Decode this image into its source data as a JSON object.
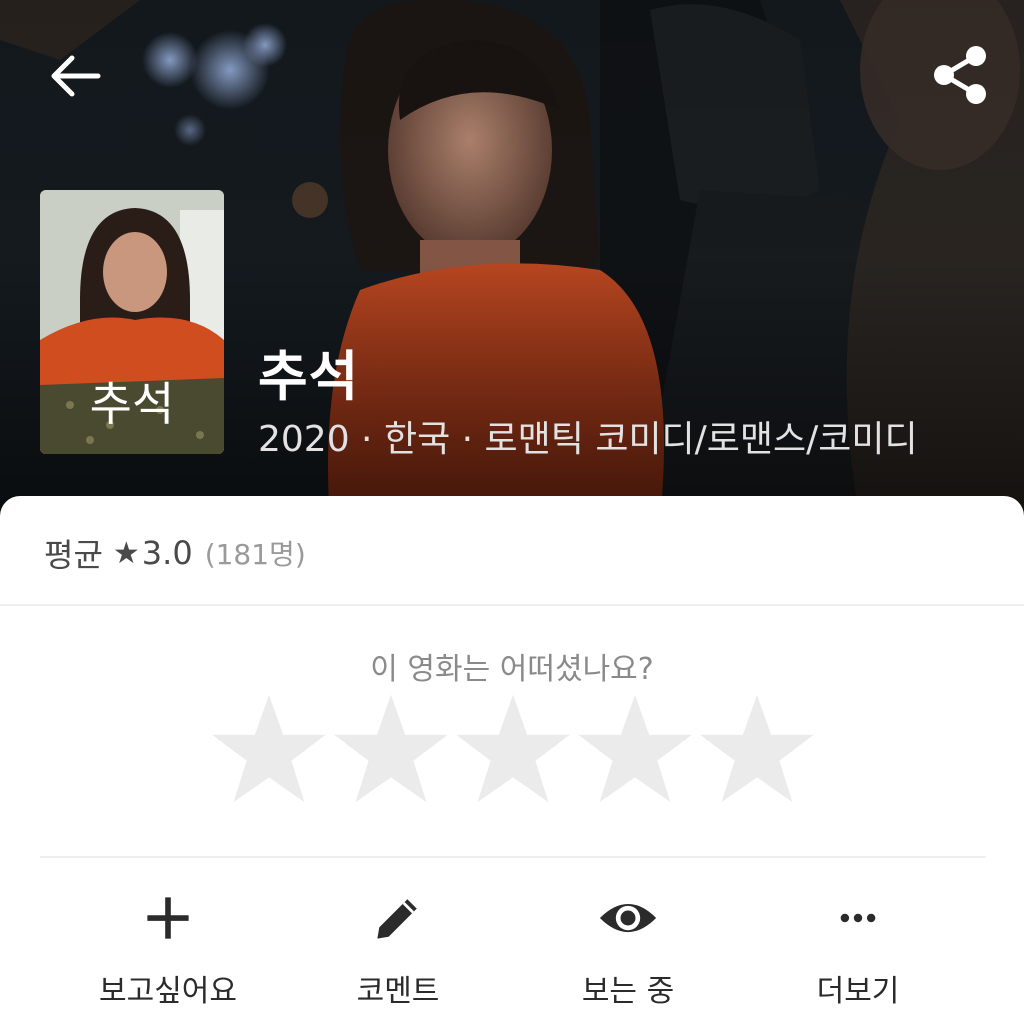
{
  "movie": {
    "title": "추석",
    "meta": "2020 · 한국 · 로맨틱 코미디/로맨스/코미디"
  },
  "poster": {
    "title_text": "추석"
  },
  "rating": {
    "label": "평균",
    "star_glyph": "★",
    "value": "3.0",
    "count": "(181명)"
  },
  "rate_prompt": {
    "question": "이 영화는 어떠셨나요?",
    "star_count": 5,
    "selected": 0,
    "empty_star_color": "#ebebeb"
  },
  "actions": [
    {
      "label": "보고싶어요",
      "icon": "plus-icon"
    },
    {
      "label": "코멘트",
      "icon": "pencil-icon"
    },
    {
      "label": "보는 중",
      "icon": "eye-icon"
    },
    {
      "label": "더보기",
      "icon": "more-dots-icon"
    }
  ],
  "header": {
    "back_icon": "arrow-left-icon",
    "share_icon": "share-icon"
  }
}
